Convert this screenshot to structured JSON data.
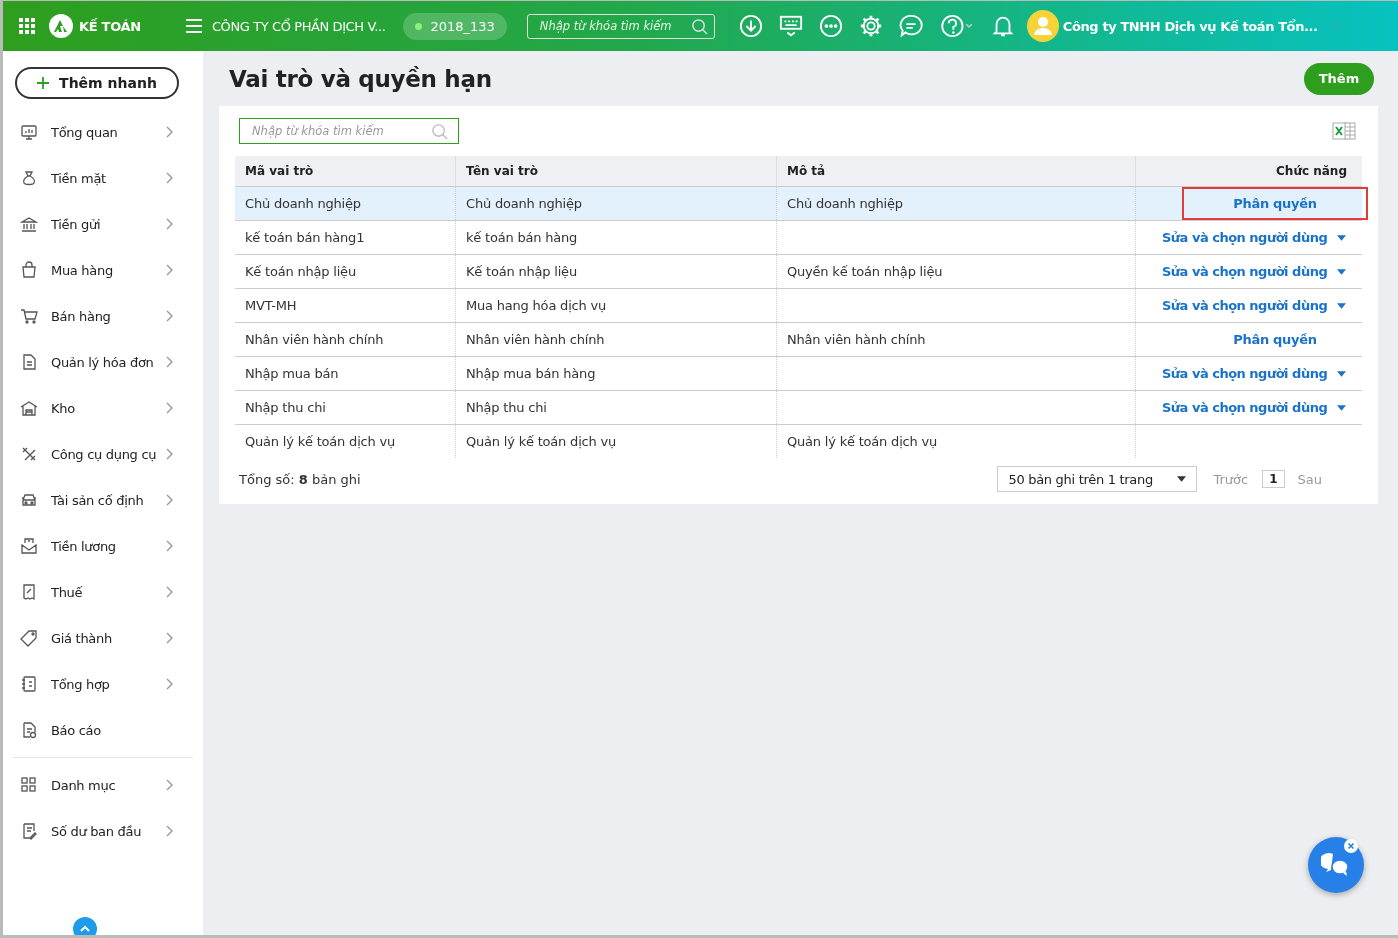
{
  "header": {
    "brand": "KẾ TOÁN",
    "company": "CÔNG TY CỔ PHẦN DỊCH V...",
    "database": "2018_133",
    "search": {
      "placeholder": "Nhập từ khóa tìm kiếm"
    },
    "user": "Công ty TNHH Dịch vụ Kế toán Tổn..."
  },
  "sidebar": {
    "quick_add": "Thêm nhanh",
    "items": [
      {
        "label": "Tổng quan",
        "expandable": true
      },
      {
        "label": "Tiền mặt",
        "expandable": true
      },
      {
        "label": "Tiền gửi",
        "expandable": true
      },
      {
        "label": "Mua hàng",
        "expandable": true
      },
      {
        "label": "Bán hàng",
        "expandable": true
      },
      {
        "label": "Quản lý hóa đơn",
        "expandable": true
      },
      {
        "label": "Kho",
        "expandable": true
      },
      {
        "label": "Công cụ dụng cụ",
        "expandable": true
      },
      {
        "label": "Tài sản cố định",
        "expandable": true
      },
      {
        "label": "Tiền lương",
        "expandable": true
      },
      {
        "label": "Thuế",
        "expandable": true
      },
      {
        "label": "Giá thành",
        "expandable": true
      },
      {
        "label": "Tổng hợp",
        "expandable": true
      },
      {
        "label": "Báo cáo",
        "expandable": false
      }
    ],
    "catalog_items": [
      {
        "label": "Danh mục",
        "expandable": true
      },
      {
        "label": "Số dư ban đầu",
        "expandable": true
      }
    ]
  },
  "page": {
    "title": "Vai trò và quyền hạn",
    "add_button": "Thêm"
  },
  "table": {
    "search": {
      "placeholder": "Nhập từ khóa tìm kiếm"
    },
    "columns": [
      "Mã vai trò",
      "Tên vai trò",
      "Mô tả",
      "Chức năng"
    ],
    "rows": [
      {
        "code": "Chủ doanh nghiệp",
        "name": "Chủ doanh nghiệp",
        "description": "Chủ doanh nghiệp",
        "selected": true,
        "action": {
          "kind": "assign",
          "label": "Phân quyền",
          "highlighted": true
        }
      },
      {
        "code": "kế toán bán hàng1",
        "name": "kế toán bán hàng",
        "selected": false,
        "action": {
          "kind": "menu",
          "label": "Sửa và chọn người dùng"
        }
      },
      {
        "code": "Kế toán nhập liệu",
        "name": "Kế toán nhập liệu",
        "description": "Quyền kế toán nhập liệu",
        "selected": false,
        "action": {
          "kind": "menu",
          "label": "Sửa và chọn người dùng"
        }
      },
      {
        "code": "MVT-MH",
        "name": "Mua hang hóa dịch vụ",
        "selected": false,
        "action": {
          "kind": "menu",
          "label": "Sửa và chọn người dùng"
        }
      },
      {
        "code": "Nhân viên hành chính",
        "name": "Nhân viên hành chính",
        "description": "Nhân viên hành chính",
        "selected": false,
        "action": {
          "kind": "assign",
          "label": "Phân quyền",
          "highlighted": false
        }
      },
      {
        "code": "Nhập mua bán",
        "name": "Nhập mua bán hàng",
        "selected": false,
        "action": {
          "kind": "menu",
          "label": "Sửa và chọn người dùng"
        }
      },
      {
        "code": "Nhập thu chi",
        "name": "Nhập thu chi",
        "selected": false,
        "action": {
          "kind": "menu",
          "label": "Sửa và chọn người dùng"
        }
      },
      {
        "code": "Quản lý kế toán dịch vụ",
        "name": "Quản lý kế toán dịch vụ",
        "description": "Quản lý kế toán dịch vụ",
        "selected": false
      }
    ]
  },
  "footer": {
    "total": "Tổng số: **8** bản ghi",
    "page_size": "50 bản ghi trên 1 trang",
    "previous": "Trước",
    "page": "1",
    "next": "Sau"
  }
}
